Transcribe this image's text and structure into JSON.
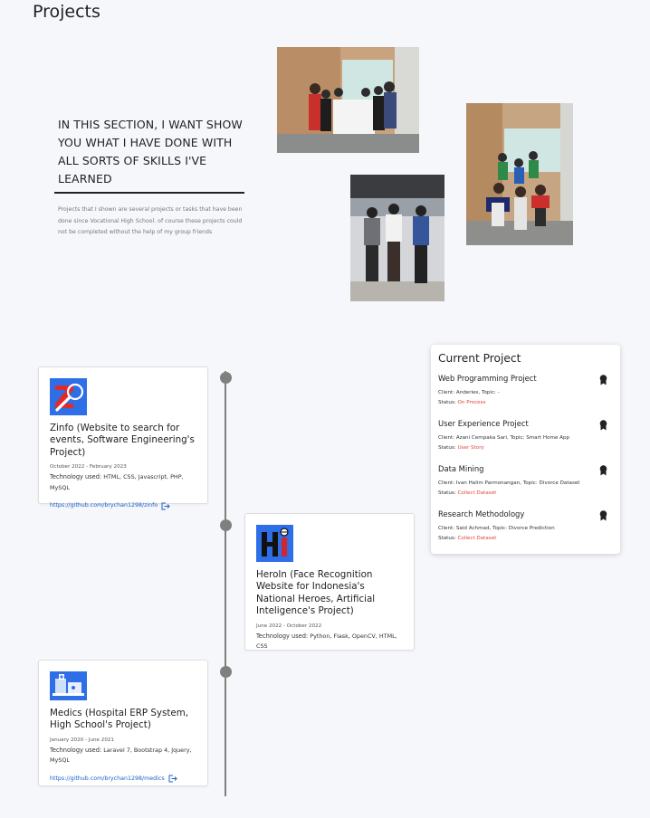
{
  "page": {
    "title": "Projects"
  },
  "intro": {
    "heading": "In this section, I want show you what I have done with all sorts of skills I've learned",
    "text": "Projects that I shown are several projects or tasks that have been done since Vocational High School. of course these projects could not be completed without the help of my group friends"
  },
  "colors": {
    "accent_link": "#1a63c8",
    "status_red": "#e0433a",
    "logo_blue": "#2e6ee6"
  },
  "timeline": {
    "projects": [
      {
        "title": "Zinfo (Website to search for events, Software Engineering's Project)",
        "date": "October 2022 - February 2023",
        "tech_label": "Technology used: ",
        "tech": "HTML, CSS, Javascript, PHP, MySQL",
        "link": "https://github.com/brychan1298/zinfo",
        "icon": "zinfo-logo"
      },
      {
        "title": "HeroIn (Face Recognition Website for Indonesia's National Heroes, Artificial Inteligence's Project)",
        "date": "June 2022 - October 2022",
        "tech_label": "Technology used: ",
        "tech": "Python, Flask, OpenCV, HTML, CSS",
        "icon": "heroin-logo"
      },
      {
        "title": "Medics (Hospital ERP System, High School's Project)",
        "date": "January 2020 - June 2021",
        "tech_label": "Technology used: ",
        "tech": "Laravel 7, Bootstrap 4, Jquery, MySQL",
        "link": "https://github.com/brychan1298/medics",
        "icon": "medics-logo"
      }
    ]
  },
  "current": {
    "title": "Current Project",
    "client_label": "Client: ",
    "topic_label": ", Topic: ",
    "status_label": "Status: ",
    "items": [
      {
        "name": "Web Programming Project",
        "client": "Anderies",
        "topic": "-",
        "status": "On Process"
      },
      {
        "name": "User Experience Project",
        "client": "Azani Cempaka Sari",
        "topic": "Smart Home App",
        "status": "User Story"
      },
      {
        "name": "Data Mining",
        "client": "Ivan Halim Parmonangan",
        "topic": "Divorce Dataset",
        "status": "Collect Dataset"
      },
      {
        "name": "Research Methodology",
        "client": "Said Achmad",
        "topic": "Divorce Prediction",
        "status": "Collect Dataset"
      }
    ]
  }
}
